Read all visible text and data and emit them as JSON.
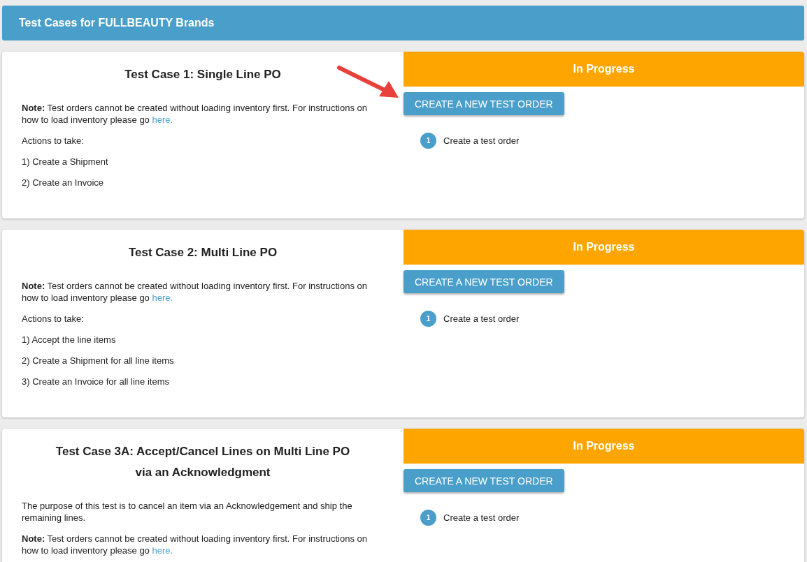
{
  "header": {
    "title": "Test Cases for FULLBEAUTY Brands"
  },
  "test_cases": [
    {
      "title": "Test Case 1: Single Line PO",
      "note": "**Note:** Test orders cannot be created without loading inventory first. For instructions on how to load inventory please go ",
      "note_link": "here.",
      "actions_heading": "Actions to take:",
      "actions": [
        "1) Create a Shipment",
        "2) Create an Invoice"
      ],
      "status": "In Progress",
      "button": "CREATE A NEW TEST ORDER",
      "steps": [
        {
          "number": "1",
          "label": "Create a test order"
        }
      ]
    },
    {
      "title": "Test Case 2: Multi Line PO",
      "note": " **Note:** Test orders cannot be created without loading inventory first. For instructions on how to load inventory please go ",
      "note_link": "here.",
      "actions_heading": "Actions to take:",
      "actions": [
        "1) Accept the line items",
        "2) Create a Shipment for all line items",
        "3) Create an Invoice for all line items"
      ],
      "status": "In Progress",
      "button": "CREATE A NEW TEST ORDER",
      "steps": [
        {
          "number": "1",
          "label": "Create a test order"
        }
      ]
    },
    {
      "title": "Test Case 3A: Accept/Cancel Lines on Multi Line PO via an Acknowledgment",
      "intro": " The purpose of this test is to cancel an item via an Acknowledgement and ship the remaining lines.",
      "note": "**Note:** Test orders cannot be created without loading inventory first. For instructions on how to load inventory please go ",
      "note_link": "here.",
      "status": "In Progress",
      "button": "CREATE A NEW TEST ORDER",
      "steps": [
        {
          "number": "1",
          "label": "Create a test order"
        }
      ]
    }
  ]
}
